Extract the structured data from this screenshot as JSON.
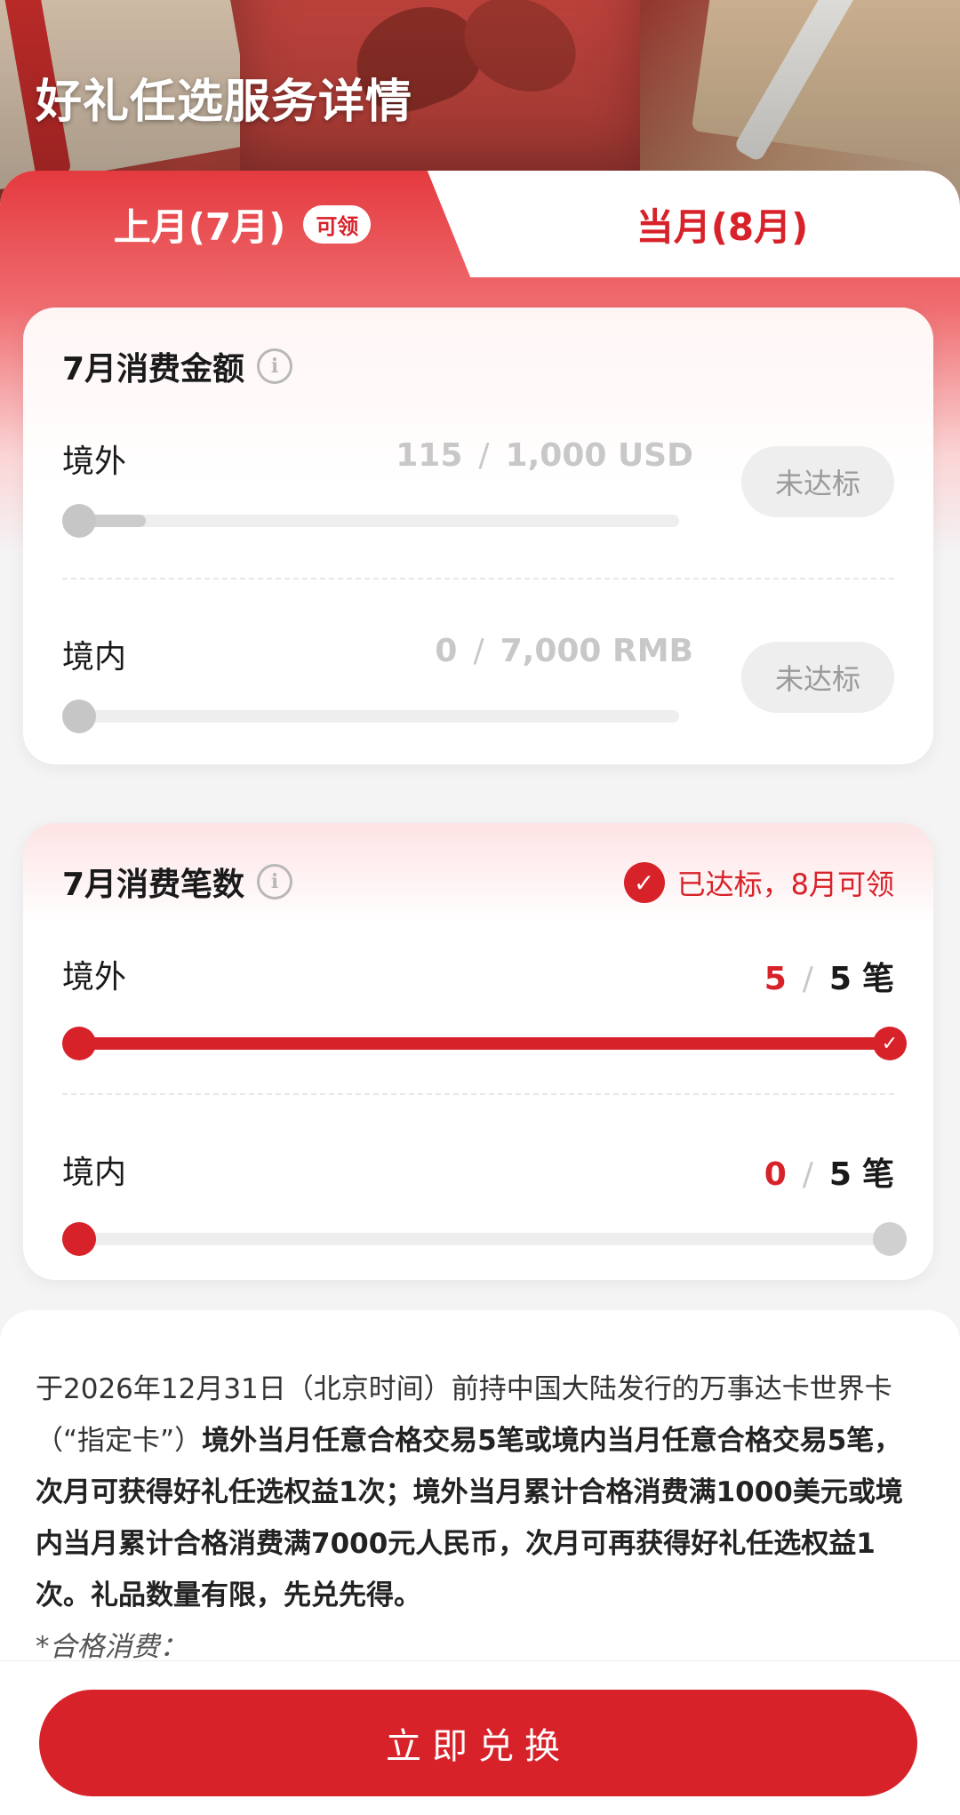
{
  "header": {
    "title": "好礼任选服务详情"
  },
  "tabs": {
    "last_month": {
      "label": "上月(7月)",
      "badge": "可领"
    },
    "this_month": {
      "label": "当月(8月)"
    }
  },
  "amount_card": {
    "title": "7月消费金额",
    "info_icon": "info-icon",
    "rows": [
      {
        "label": "境外",
        "current": "115",
        "target": "1,000 USD",
        "progress": 0.115,
        "status": "未达标"
      },
      {
        "label": "境内",
        "current": "0",
        "target": "7,000 RMB",
        "progress": 0,
        "status": "未达标"
      }
    ]
  },
  "count_card": {
    "title": "7月消费笔数",
    "info_icon": "info-icon",
    "status": "已达标，8月可领",
    "rows": [
      {
        "label": "境外",
        "current": "5",
        "target": "5",
        "unit": "笔",
        "progress": 1.0,
        "complete": true
      },
      {
        "label": "境内",
        "current": "0",
        "target": "5",
        "unit": "笔",
        "progress": 0,
        "complete": false
      }
    ]
  },
  "terms": {
    "intro": "于2026年12月31日（北京时间）前持中国大陆发行的万事达卡世界卡（“指定卡”）",
    "bold": "境外当月任意合格交易5笔或境内当月任意合格交易5笔，次月可获得好礼任选权益1次；境外当月累计合格消费满1000美元或境内当月累计合格消费满7000元人民币，次月可再获得好礼任选权益1次。礼品数量有限，先兑先得。",
    "note": "*合格消费："
  },
  "cta": {
    "label": "立即兑换"
  },
  "colors": {
    "brand_red": "#d8222a",
    "muted_grey": "#c8c8c8",
    "track_grey": "#eeeeee"
  }
}
